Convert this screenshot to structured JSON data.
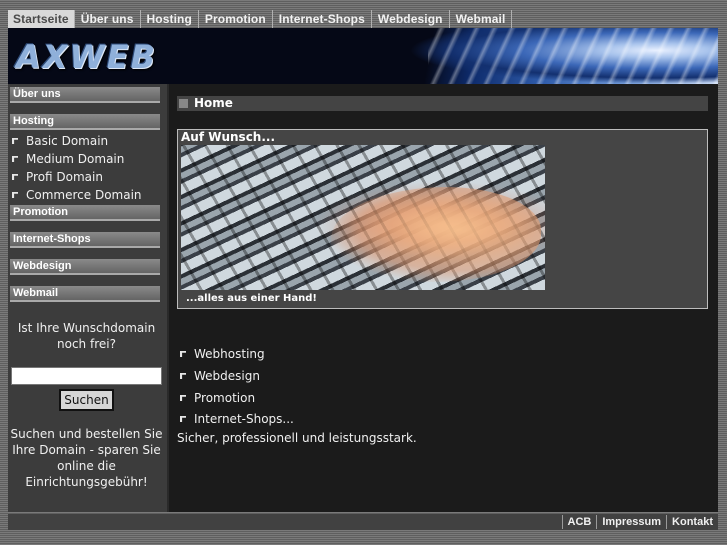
{
  "top_nav": [
    {
      "label": "Startseite",
      "active": true
    },
    {
      "label": "Über uns"
    },
    {
      "label": "Hosting"
    },
    {
      "label": "Promotion"
    },
    {
      "label": "Internet-Shops"
    },
    {
      "label": "Webdesign"
    },
    {
      "label": "Webmail"
    }
  ],
  "logo": "AXWEB",
  "sidebar": {
    "ueber_uns": "Über uns",
    "hosting": "Hosting",
    "hosting_items": [
      "Basic Domain",
      "Medium Domain",
      "Profi Domain",
      "Commerce Domain"
    ],
    "promotion": "Promotion",
    "internet_shops": "Internet-Shops",
    "webdesign": "Webdesign",
    "webmail": "Webmail",
    "domain_question_1": "Ist Ihre Wunschdomain",
    "domain_question_2": "noch frei?",
    "search_value": "",
    "search_button": "Suchen",
    "info_1": "Suchen und bestellen Sie",
    "info_2": "Ihre Domain - sparen Sie",
    "info_3": "online die",
    "info_4": "Einrichtungsgebühr!"
  },
  "main": {
    "section_title": "Home",
    "promo_title": "Auf Wunsch...",
    "promo_caption": "...alles aus einer Hand!",
    "features": [
      "Webhosting",
      "Webdesign",
      "Promotion",
      "Internet-Shops..."
    ],
    "tagline": "Sicher, professionell und leistungsstark."
  },
  "footer": {
    "links": [
      "ACB",
      "Impressum",
      "Kontakt"
    ]
  },
  "colors": {
    "background": "#6d6d6d",
    "sidebar": "#3c3c3c",
    "main": "#1b1b1b",
    "active_tab": "#d9d9d9"
  }
}
